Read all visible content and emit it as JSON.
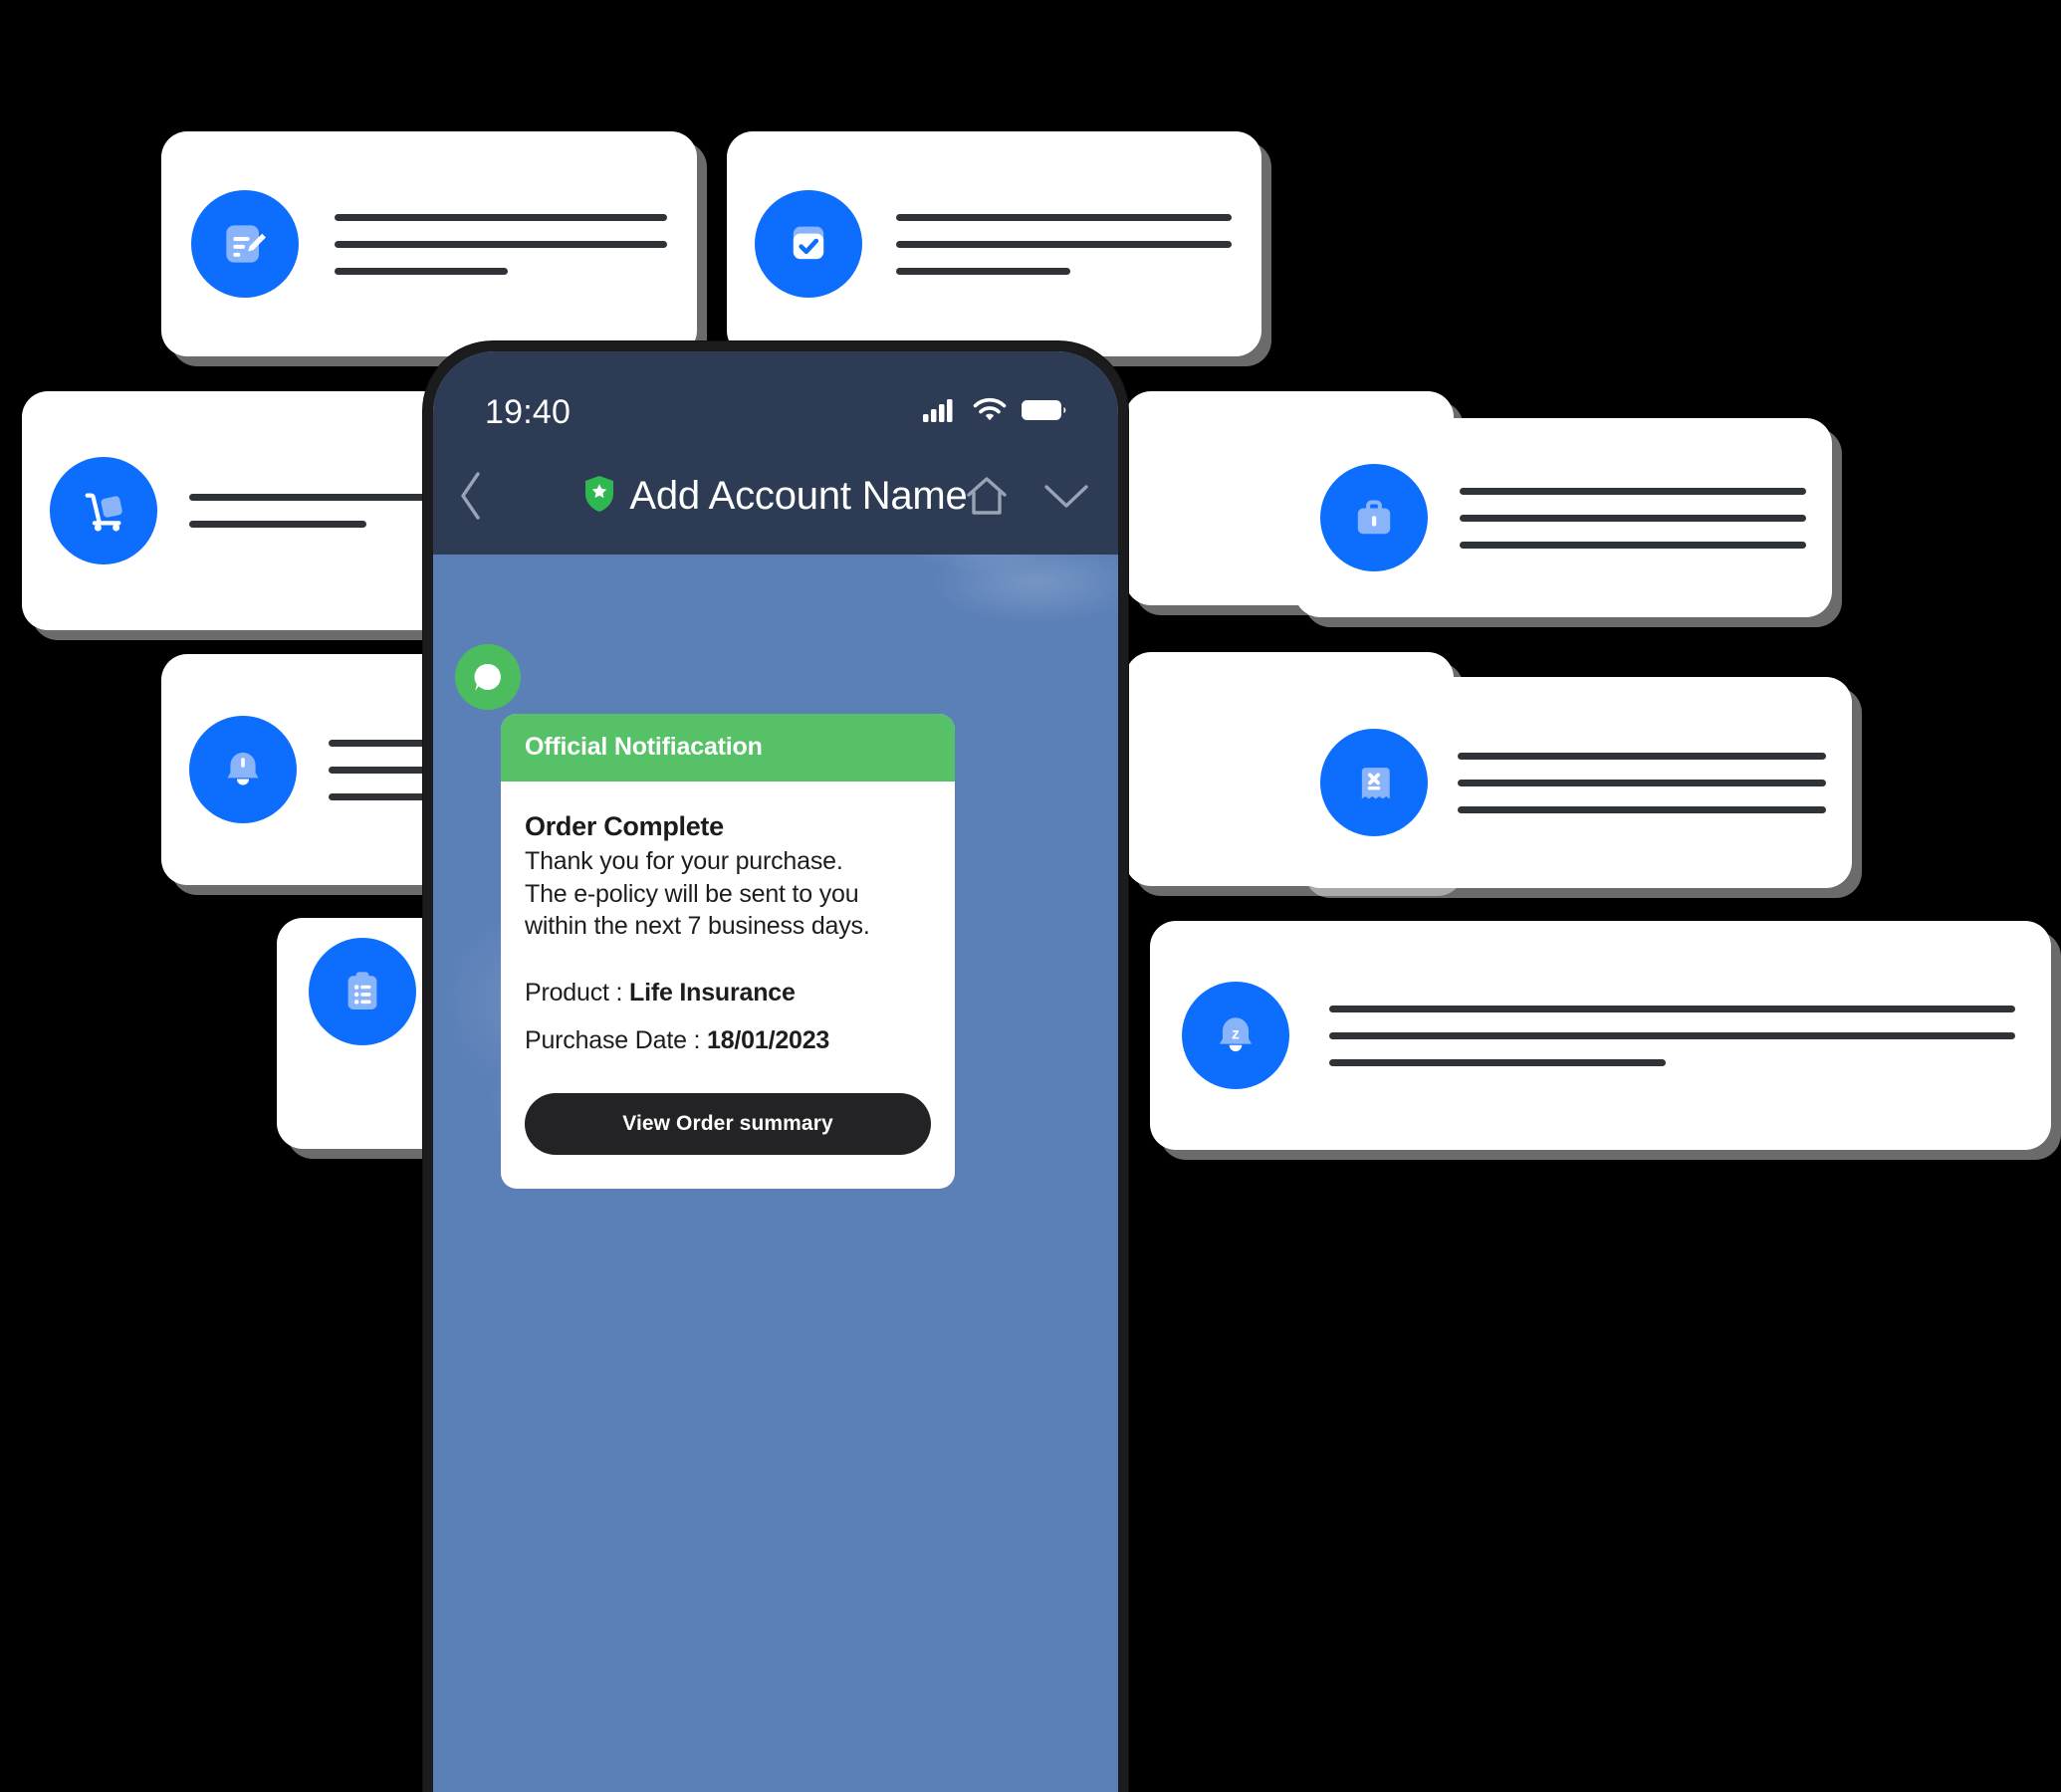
{
  "background_cards": [
    {
      "id": "note-edit",
      "icon": "note-edit-icon",
      "lines": 3
    },
    {
      "id": "task-check",
      "icon": "checkbox-check-icon",
      "lines": 3
    },
    {
      "id": "delivery",
      "icon": "hand-truck-icon",
      "lines": 2
    },
    {
      "id": "briefcase",
      "icon": "briefcase-icon",
      "lines": 3
    },
    {
      "id": "bell",
      "icon": "bell-icon",
      "lines": 3
    },
    {
      "id": "blank-mid",
      "icon": "none",
      "lines": 0
    },
    {
      "id": "receipt",
      "icon": "receipt-x-icon",
      "lines": 3
    },
    {
      "id": "clipboard",
      "icon": "clipboard-list-icon",
      "lines": 0
    },
    {
      "id": "snooze",
      "icon": "bell-snooze-icon",
      "lines": 3
    }
  ],
  "colors": {
    "page_background": "#000000",
    "card_background": "#ffffff",
    "icon_circle_blue": "#0d6efd",
    "icon_glyph_light_blue": "#8ab4fa",
    "phone_bezel": "#1c1c1e",
    "phone_header": "#2d3c54",
    "phone_screen_sky": "#5b80b8",
    "notification_green": "#56c167",
    "avatar_green": "#4cbd5f",
    "button_dark": "#232325",
    "shield_green": "#2eb84f"
  },
  "phone": {
    "status_bar": {
      "time": "19:40",
      "icons": [
        "cellular-signal-icon",
        "wifi-icon",
        "battery-icon"
      ]
    },
    "nav_bar": {
      "back_icon": "chevron-left-icon",
      "badge_icon": "shield-star-icon",
      "title": "Add Account Name",
      "home_icon": "home-icon",
      "collapse_icon": "chevron-down-icon"
    },
    "conversation": {
      "avatar_icon": "chat-bubble-icon",
      "notification": {
        "header": "Official Notifiacation",
        "title": "Order Complete",
        "message_lines": [
          "Thank you for your purchase.",
          "The e-policy will be sent to you",
          "within the next 7 business days."
        ],
        "details": [
          {
            "label": "Product : ",
            "value": "Life Insurance"
          },
          {
            "label": "Purchase Date : ",
            "value": "18/01/2023"
          }
        ],
        "button_label": "View Order summary"
      }
    }
  }
}
